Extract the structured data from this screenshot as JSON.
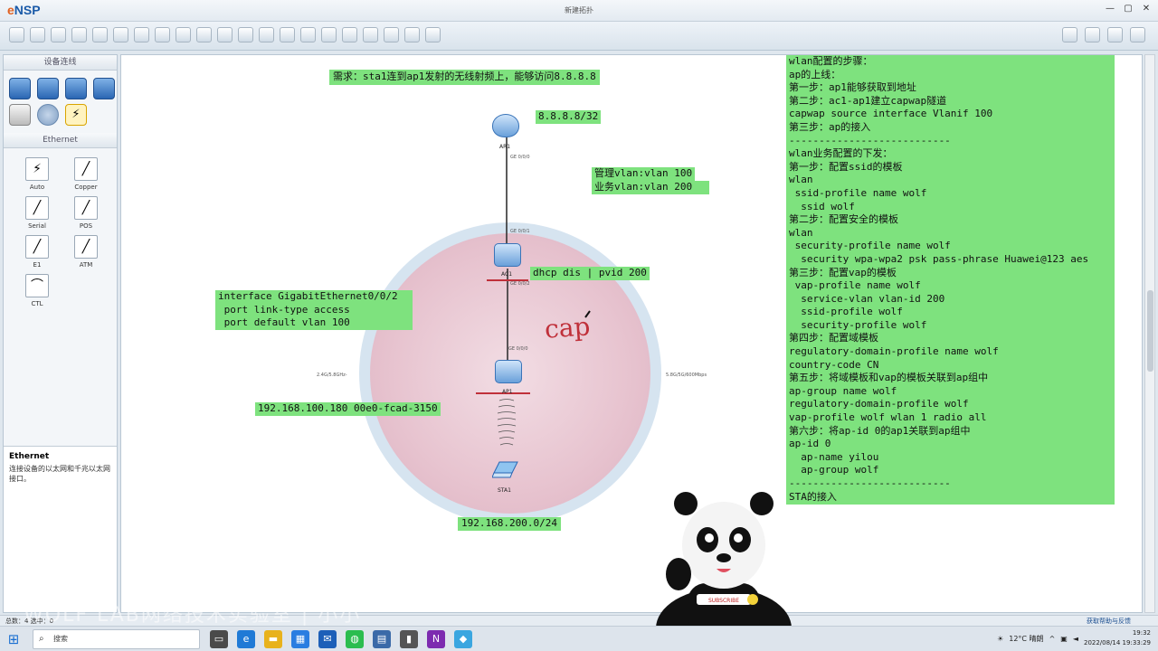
{
  "window": {
    "app_name_prefix": "e",
    "app_name": "NSP",
    "title": "新建拓扑",
    "controls": [
      "—",
      "▢",
      "✕"
    ]
  },
  "toolbar": {
    "left_icons": [
      "new-topology-icon",
      "open-icon",
      "save-icon",
      "save-as-icon",
      "print-icon",
      "undo-icon",
      "redo-icon",
      "select-icon",
      "hand-icon",
      "delete-icon",
      "clear-icon",
      "text-icon",
      "rect-icon",
      "zoom-in-icon",
      "zoom-out-icon",
      "fit-icon",
      "start-icon",
      "stop-icon",
      "capture-icon",
      "topo-icon",
      "cmd-icon"
    ],
    "right_icons": [
      "message-icon",
      "settings-icon",
      "help-icon",
      "huawei-icon"
    ]
  },
  "left_panel": {
    "devices_header": "设备连线",
    "ethernet_header": "Ethernet",
    "cables": [
      {
        "label": "Auto",
        "glyph": "⚡"
      },
      {
        "label": "Copper",
        "glyph": "╱"
      },
      {
        "label": "Serial",
        "glyph": "╱"
      },
      {
        "label": "POS",
        "glyph": "╱"
      },
      {
        "label": "E1",
        "glyph": "╱"
      },
      {
        "label": "ATM",
        "glyph": "╱"
      },
      {
        "label": "CTL",
        "glyph": "⌒"
      }
    ],
    "desc_title": "Ethernet",
    "desc_text": "连接设备的以太网和千兆以太网接口。"
  },
  "canvas": {
    "requirement": "需求：sta1连到ap1发射的无线射频上，能够访问8.8.8.8",
    "ip_8888": "8.8.8.8/32",
    "vlan_mgmt": "管理vlan:vlan 100",
    "vlan_biz": "业务vlan:vlan 200",
    "dhcp_cmd": "dhcp dis | pvid 200",
    "interface_cfg": [
      "interface GigabitEthernet0/0/2",
      " port link-type access",
      " port default vlan 100"
    ],
    "ap_ip": "192.168.100.180 00e0-fcad-3150",
    "sta_net": "192.168.200.0/24",
    "handwriting": "cap",
    "nodes": {
      "ar1": "AR1",
      "ac1": "AC1",
      "ap1": "AP1",
      "sta1": "STA1"
    },
    "ports": {
      "ar1_port": "GE 0/0/0",
      "ac1_up": "GE 0/0/1",
      "ac1_down": "GE 0/0/2",
      "ap1_port": "GE 0/0/0"
    },
    "radio_left": "2.4G/5.8GHz-",
    "radio_right": "5.8G/5G/600Mbps",
    "config_lines": [
      "wlan配置的步骤：",
      "ap的上线：",
      "第一步：ap1能够获取到地址",
      "第二步：ac1-ap1建立capwap隧道",
      "capwap source interface Vlanif 100",
      "第三步：ap的接入",
      "---------------------------",
      "wlan业务配置的下发：",
      "第一步：配置ssid的模板",
      "wlan",
      " ssid-profile name wolf",
      "  ssid wolf",
      "第二步：配置安全的模板",
      "wlan",
      " security-profile name wolf",
      "  security wpa-wpa2 psk pass-phrase Huawei@123 aes",
      "第三步：配置vap的模板",
      " vap-profile name wolf",
      "  service-vlan vlan-id 200",
      "  ssid-profile wolf",
      "  security-profile wolf",
      "第四步：配置域模板",
      "regulatory-domain-profile name wolf",
      "country-code CN",
      "第五步：将域模板和vap的模板关联到ap组中",
      "ap-group name wolf",
      "regulatory-domain-profile wolf",
      "vap-profile wolf wlan 1 radio all",
      "第六步：将ap-id 0的ap1关联到ap组中",
      "ap-id 0",
      "  ap-name yilou",
      "  ap-group wolf",
      "---------------------------",
      "STA的接入"
    ]
  },
  "statusbar": {
    "left": "总数：4 选中：0",
    "right": "获取帮助与反馈"
  },
  "taskbar": {
    "search_placeholder": "搜索",
    "weather": "12°C 晴朗",
    "time": "19:32",
    "date": "2022/08/14 19:33:29"
  },
  "watermark": "WOLF LAB网络技术实验室 | 小小",
  "mascot_badge": "SUBSCRIBE",
  "colors": {
    "note_green": "#7ee27e",
    "accent_blue": "#1a5aa8",
    "ink_red": "#c0303a"
  }
}
